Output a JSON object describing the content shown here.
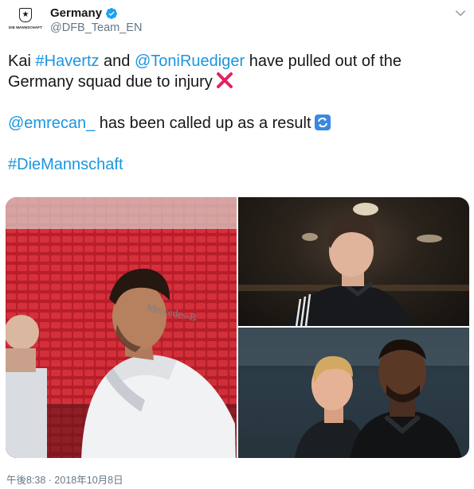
{
  "header": {
    "display_name": "Germany",
    "handle": "@DFB_Team_EN",
    "avatar_wordmark": "DIE MANNSCHAFT",
    "verified": true
  },
  "tweet": {
    "line1": {
      "t1": "Kai ",
      "link1": "#Havertz",
      "t2": " and ",
      "link2": "@ToniRuediger",
      "t3": " have pulled out of the"
    },
    "line2": {
      "t1": "Germany squad due to injury"
    },
    "line3": {
      "link1": "@emrecan_",
      "t1": " has been called up as a result"
    },
    "line4": {
      "link1": "#DieMannschaft"
    }
  },
  "media": {
    "left_shirt_text": "Mercedes-B"
  },
  "footer": {
    "timestamp": "午後8:38 · 2018年10月8日"
  },
  "colors": {
    "link": "#1b95e0",
    "verified": "#1da1f2",
    "meta": "#657786",
    "emoji_x": "#e0245e",
    "emoji_cycle": "#3a89e0"
  }
}
